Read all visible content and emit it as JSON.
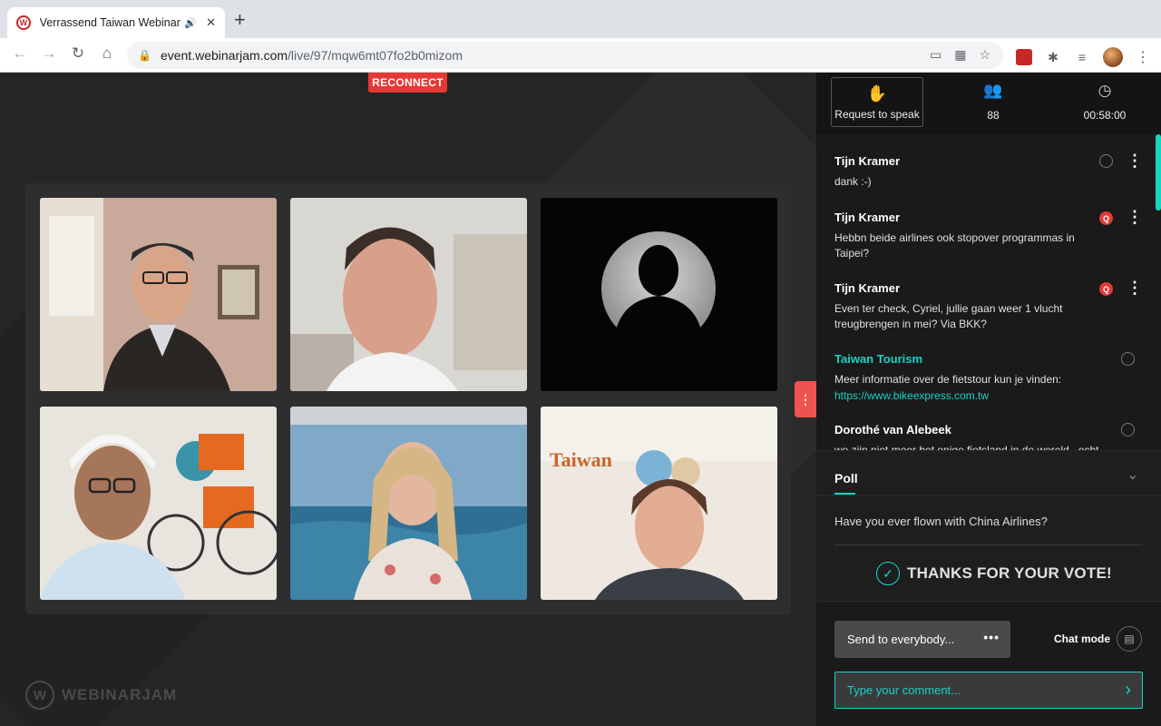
{
  "browser": {
    "tab_title": "Verrassend Taiwan Webinar",
    "url_host": "event.webinarjam.com",
    "url_path": "/live/97/mqw6mt07fo2b0mizom"
  },
  "stage": {
    "reconnect_label": "RECONNECT",
    "brand_name": "WEBINARJAM"
  },
  "panel": {
    "request_label": "Request to speak",
    "attendees": "88",
    "timer": "00:58:00"
  },
  "chat": {
    "messages": [
      {
        "author": "Tijn Kramer",
        "text": "dank :-)",
        "badge": "ring"
      },
      {
        "author": "Tijn Kramer",
        "text": "Hebbn beide airlines ook stopover programmas in Taipei?",
        "badge": "Q"
      },
      {
        "author": "Tijn Kramer",
        "text": "Even ter check, Cyriel, jullie gaan weer 1 vlucht treugbrengen in mei? Via BKK?",
        "badge": "Q"
      },
      {
        "author": "Taiwan Tourism",
        "text": "Meer informatie over de fietstour kun je vinden:",
        "link": "https://www.bikeexpress.com.tw",
        "badge": "ring"
      },
      {
        "author": "Dorothé van Alebeek",
        "text": "we zijn niet meer het enige fietsland in de wereld.. echt",
        "badge": "ring"
      }
    ]
  },
  "poll": {
    "tab_label": "Poll",
    "question": "Have you ever flown with China Airlines?",
    "thanks": "THANKS FOR YOUR VOTE!"
  },
  "composer": {
    "send_to": "Send to everybody...",
    "chat_mode": "Chat mode",
    "placeholder": "Type your comment..."
  },
  "colors": {
    "accent": "#19d3c5",
    "alert": "#e53935"
  }
}
